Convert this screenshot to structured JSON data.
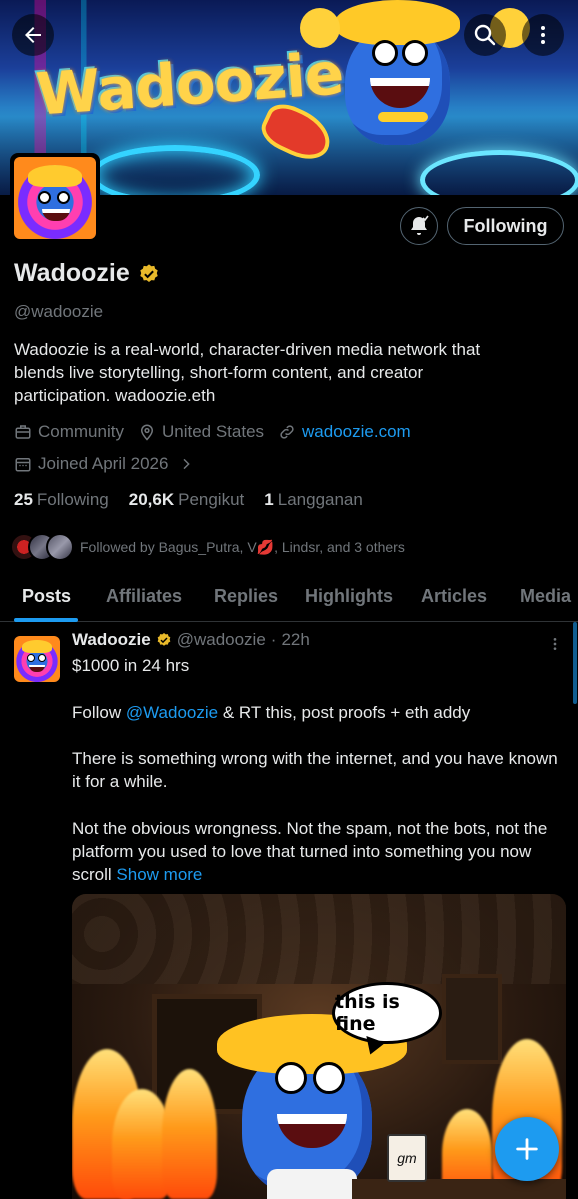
{
  "header": {
    "back_icon": "arrow-left-icon",
    "search_icon": "search-icon",
    "more_icon": "more-vertical-icon",
    "banner_logo_text": "Wadoozie"
  },
  "profile": {
    "name": "Wadoozie",
    "verified": true,
    "handle": "@wadoozie",
    "bio": "Wadoozie is a real-world, character-driven media network that blends live storytelling, short-form content, and creator participation. wadoozie.eth",
    "category": "Community",
    "location": "United States",
    "website": "wadoozie.com",
    "joined": "Joined April 2026",
    "following_button": "Following",
    "stats": {
      "following_count": "25",
      "following_label": "Following",
      "followers_count": "20,6K",
      "followers_label": "Pengikut",
      "subscriptions_count": "1",
      "subscriptions_label": "Langganan"
    },
    "followed_by": "Followed by Bagus_Putra, V💋, Lindsr, and 3 others"
  },
  "tabs": [
    {
      "label": "Posts",
      "active": true
    },
    {
      "label": "Affiliates"
    },
    {
      "label": "Replies"
    },
    {
      "label": "Highlights"
    },
    {
      "label": "Articles"
    },
    {
      "label": "Media"
    }
  ],
  "post": {
    "author": "Wadoozie",
    "handle": "@wadoozie",
    "separator": "·",
    "time": "22h",
    "line1": "$1000 in 24 hrs",
    "line2_prefix": "Follow ",
    "line2_mention": "@Wadoozie",
    "line2_suffix": " & RT this, post proofs + eth addy",
    "para2": "There is something wrong with the internet, and you have known it for a while.",
    "para3": "Not the obvious wrongness. Not the spam, not the bots, not the platform you used to love that turned into something you now scroll",
    "show_more": "Show more",
    "image": {
      "speech_bubble": "this is fine",
      "mug_text": "gm"
    }
  },
  "colors": {
    "accent": "#1d9bf0",
    "background": "#000000",
    "muted": "#71767b",
    "verified_badge": "#e8b92a"
  },
  "fab_icon": "plus-icon"
}
